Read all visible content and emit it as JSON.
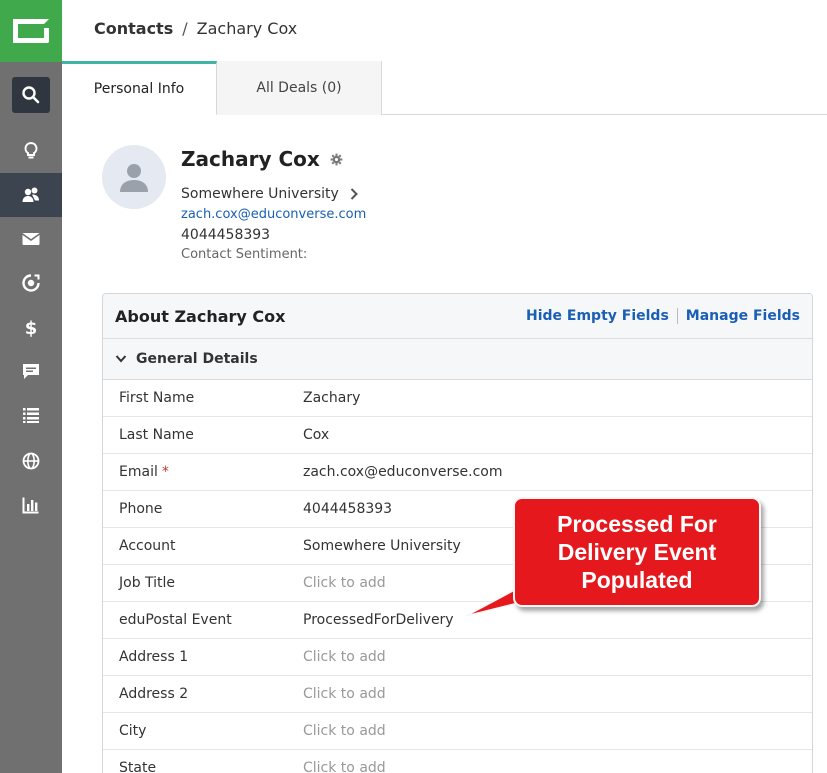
{
  "header": {
    "breadcrumb_root": "Contacts",
    "breadcrumb_separator": "/",
    "breadcrumb_leaf": "Zachary Cox"
  },
  "tabs": [
    {
      "label": "Personal Info",
      "active": true
    },
    {
      "label": "All Deals (0)",
      "active": false
    }
  ],
  "sidebar": {
    "items": [
      {
        "icon": "search-icon",
        "active": false
      },
      {
        "icon": "lightbulb-icon",
        "active": false
      },
      {
        "icon": "contacts-icon",
        "active": true
      },
      {
        "icon": "mail-icon",
        "active": false
      },
      {
        "icon": "automation-icon",
        "active": false
      },
      {
        "icon": "dollar-icon",
        "active": false
      },
      {
        "icon": "chat-icon",
        "active": false
      },
      {
        "icon": "list-icon",
        "active": false
      },
      {
        "icon": "globe-icon",
        "active": false
      },
      {
        "icon": "reports-icon",
        "active": false
      }
    ]
  },
  "profile": {
    "name": "Zachary Cox",
    "account": "Somewhere University",
    "email": "zach.cox@educonverse.com",
    "phone": "4044458393",
    "sentiment_label": "Contact Sentiment:"
  },
  "about": {
    "title": "About Zachary Cox",
    "hide_empty_label": "Hide Empty Fields",
    "manage_fields_label": "Manage Fields",
    "section_title": "General Details",
    "fields": [
      {
        "label": "First Name",
        "value": "Zachary",
        "empty": false,
        "required": false
      },
      {
        "label": "Last Name",
        "value": "Cox",
        "empty": false,
        "required": false
      },
      {
        "label": "Email",
        "value": "zach.cox@educonverse.com",
        "empty": false,
        "required": true
      },
      {
        "label": "Phone",
        "value": "4044458393",
        "empty": false,
        "required": false
      },
      {
        "label": "Account",
        "value": "Somewhere University",
        "empty": false,
        "required": false
      },
      {
        "label": "Job Title",
        "value": "Click to add",
        "empty": true,
        "required": false
      },
      {
        "label": "eduPostal Event",
        "value": "ProcessedForDelivery",
        "empty": false,
        "required": false
      },
      {
        "label": "Address 1",
        "value": "Click to add",
        "empty": true,
        "required": false
      },
      {
        "label": "Address 2",
        "value": "Click to add",
        "empty": true,
        "required": false
      },
      {
        "label": "City",
        "value": "Click to add",
        "empty": true,
        "required": false
      },
      {
        "label": "State",
        "value": "Click to add",
        "empty": true,
        "required": false
      }
    ],
    "required_marker": "*"
  },
  "callout": {
    "text": "Processed For Delivery Event Populated"
  },
  "colors": {
    "brand_green": "#3fa94b",
    "sidebar": "#707070",
    "active_tab": "#3fb5a5",
    "link": "#1a5fb4",
    "callout_red": "#e5191d"
  }
}
